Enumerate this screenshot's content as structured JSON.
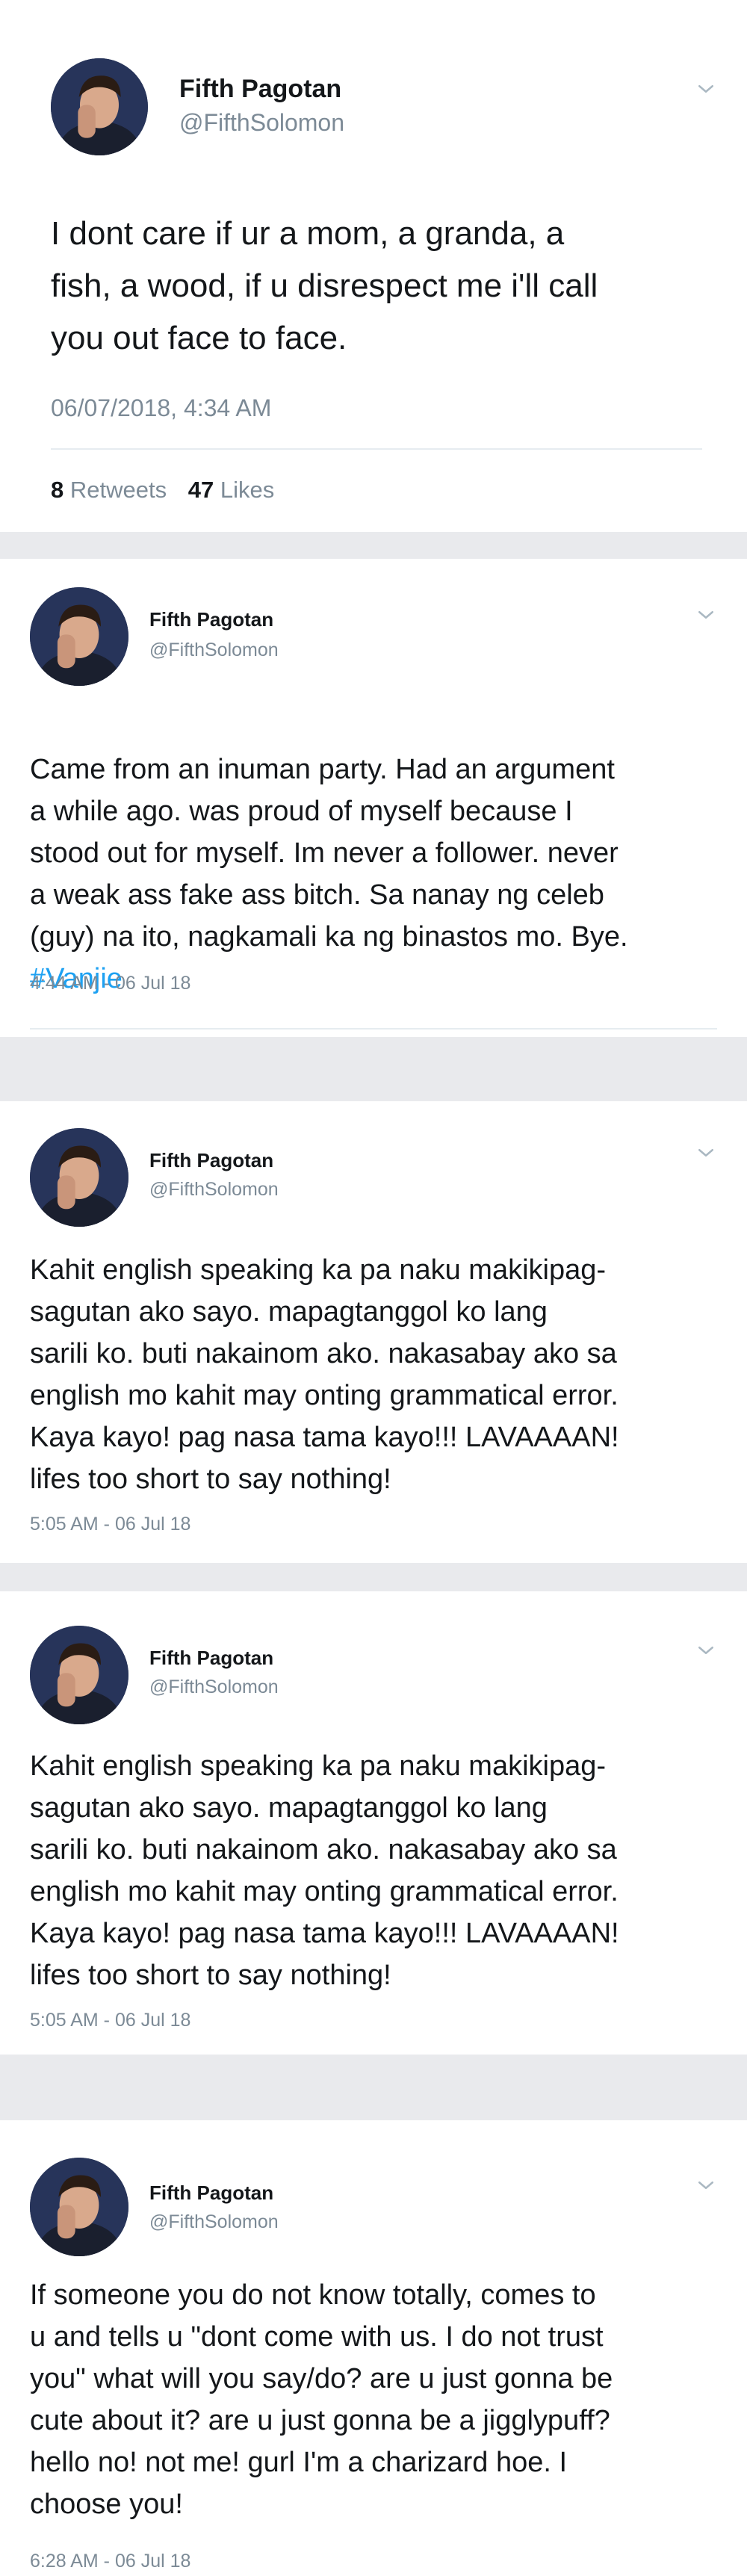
{
  "tweets": [
    {
      "name": "Fifth Pagotan",
      "handle": "@FifthSolomon",
      "text": "I dont care if ur a mom, a granda, a\nfish, a wood, if u disrespect me i'll call\nyou out face to face.",
      "hashtag": "",
      "timestamp": "06/07/2018, 4:34 AM",
      "retweet_count": "8",
      "retweets_label": "Retweets",
      "like_count": "47",
      "likes_label": "Likes"
    },
    {
      "name": "Fifth Pagotan",
      "handle": "@FifthSolomon",
      "text": "Came from an inuman party. Had an argument\na while ago. was proud of myself because I\nstood out for myself. Im never a follower. never\na weak ass fake ass bitch. Sa nanay  ng celeb\n(guy) na ito, nagkamali ka ng binastos mo. Bye.",
      "hashtag": "#Vanjie",
      "timestamp": "4:44 AM - 06 Jul 18"
    },
    {
      "name": "Fifth Pagotan",
      "handle": "@FifthSolomon",
      "text": "Kahit english speaking ka pa naku makikipag-\nsagutan ako sayo. mapagtanggol ko lang\nsarili ko. buti nakainom ako. nakasabay ako sa\nenglish mo kahit may onting grammatical error.\nKaya kayo! pag nasa tama kayo!!! LAVAAAAN!\nlifes too short to say nothing!",
      "timestamp": "5:05 AM - 06 Jul 18"
    },
    {
      "name": "Fifth Pagotan",
      "handle": "@FifthSolomon",
      "text": "Kahit english speaking ka pa naku makikipag-\nsagutan ako sayo. mapagtanggol ko lang\nsarili ko. buti nakainom ako. nakasabay ako sa\nenglish mo kahit may onting grammatical error.\nKaya kayo! pag nasa tama kayo!!! LAVAAAAN!\nlifes too short to say nothing!",
      "timestamp": "5:05 AM - 06 Jul 18"
    },
    {
      "name": "Fifth Pagotan",
      "handle": "@FifthSolomon",
      "text": "If someone you do not know totally, comes to\nu and tells u \"dont come with us. I do not trust\nyou\" what will you say/do? are u just gonna be\ncute about it? are u just gonna be a jigglypuff?\nhello no! not me! gurl  I'm a charizard hoe. I\nchoose you!",
      "timestamp": "6:28 AM - 06 Jul 18"
    }
  ],
  "colors": {
    "background": "#e9eaed",
    "card": "#ffffff",
    "text": "#14171a",
    "secondary": "#7c8a96",
    "link": "#1da1f2"
  },
  "icons": {
    "avatar": "profile-photo",
    "menu": "chevron-down-icon"
  }
}
